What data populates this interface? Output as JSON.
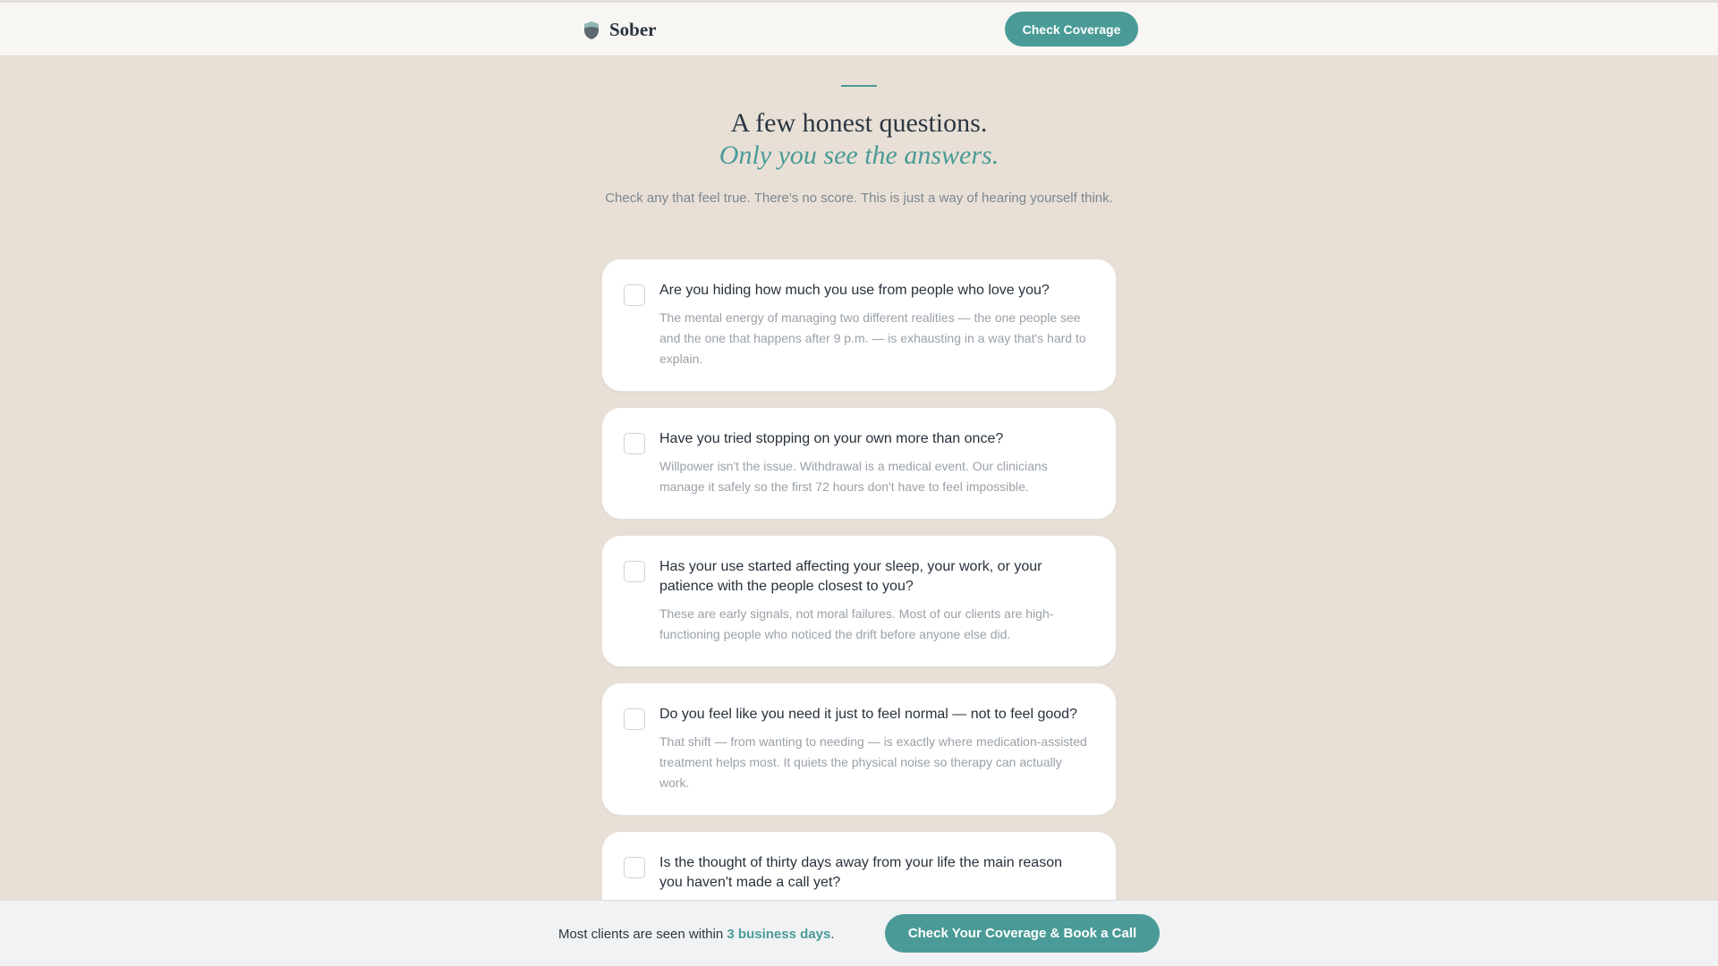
{
  "header": {
    "brand_name": "Sober",
    "brand_icon": "shield-icon",
    "cta_label": "Check Coverage"
  },
  "hero": {
    "title_line1": "A few honest questions.",
    "title_line2": "Only you see the answers.",
    "intro": "Check any that feel true. There's no score. This is just a way of hearing yourself think."
  },
  "questions": [
    {
      "question": "Are you hiding how much you use from people who love you?",
      "answer": "The mental energy of managing two different realities — the one people see and the one that happens after 9 p.m. — is exhausting in a way that's hard to explain.",
      "checked": false
    },
    {
      "question": "Have you tried stopping on your own more than once?",
      "answer": "Willpower isn't the issue. Withdrawal is a medical event. Our clinicians manage it safely so the first 72 hours don't have to feel impossible.",
      "checked": false
    },
    {
      "question": "Has your use started affecting your sleep, your work, or your patience with the people closest to you?",
      "answer": "These are early signals, not moral failures. Most of our clients are high-functioning people who noticed the drift before anyone else did.",
      "checked": false
    },
    {
      "question": "Do you feel like you need it just to feel normal — not to feel good?",
      "answer": "That shift — from wanting to needing — is exactly where medication-assisted treatment helps most. It quiets the physical noise so therapy can actually work.",
      "checked": false
    },
    {
      "question": "Is the thought of thirty days away from your life the main reason you haven't made a call yet?",
      "answer": "",
      "checked": false
    }
  ],
  "footer": {
    "text_before": "Most clients are seen within ",
    "highlight": "3 business days",
    "text_after": ".",
    "cta_label": "Check Your Coverage & Book a Call"
  },
  "colors": {
    "accent": "#4a9b97",
    "background": "#e8e0d6"
  }
}
